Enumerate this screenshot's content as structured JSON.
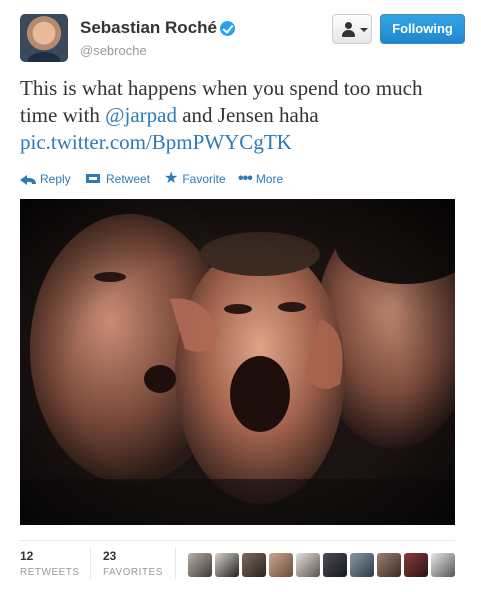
{
  "author": {
    "name": "Sebastian Roché",
    "handle": "@sebroche",
    "verified": true
  },
  "header_buttons": {
    "user_dropdown_icon": "user-icon",
    "following_label": "Following"
  },
  "tweet": {
    "text_before": "This is what happens when you spend too much time with",
    "mention": "@jarpad",
    "text_after": "and Jensen haha",
    "media_link": "pic.twitter.com/BpmPWYCgTK"
  },
  "actions": {
    "reply": "Reply",
    "retweet": "Retweet",
    "favorite": "Favorite",
    "more": "More"
  },
  "stats": {
    "retweets_count": "12",
    "retweets_label": "RETWEETS",
    "favorites_count": "23",
    "favorites_label": "FAVORITES"
  },
  "colors": {
    "link": "#2b7bb9",
    "follow_button": "#2a96db",
    "verified_badge": "#2aa3ef"
  }
}
